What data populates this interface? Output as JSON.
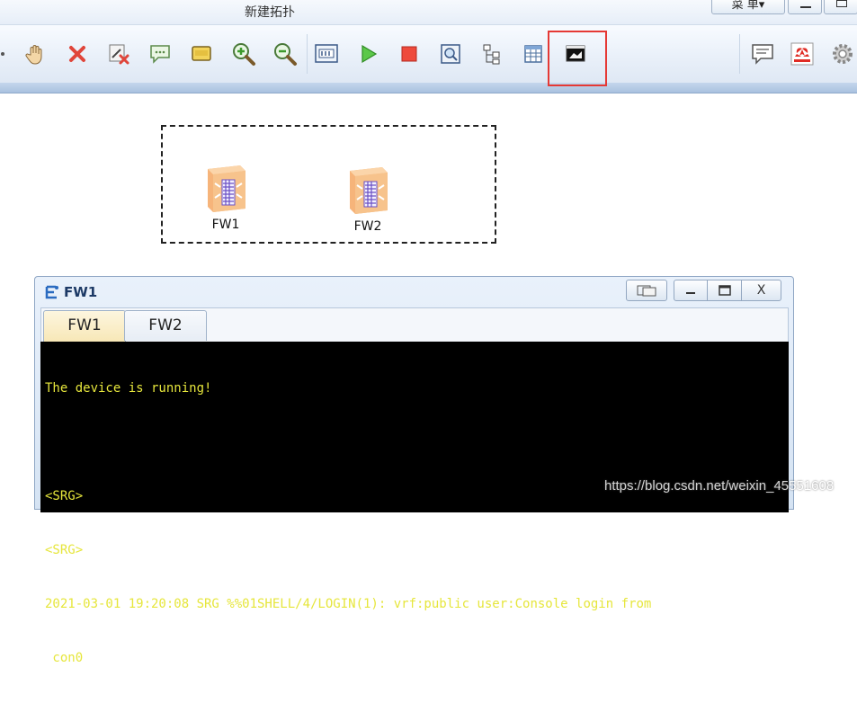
{
  "app": {
    "title": "新建拓扑",
    "menu_label": "菜 单▾"
  },
  "toolbar": {
    "buttons": [
      "hand-drag-icon",
      "delete-icon",
      "delete-link-icon",
      "text-comment-icon",
      "palette-icon",
      "zoom-in-icon",
      "zoom-out-icon",
      "topology-id-icon",
      "start-device-icon",
      "stop-device-icon",
      "capture-icon",
      "tree-view-icon",
      "grid-icon",
      "console-cli-icon",
      "chat-icon",
      "huawei-icon",
      "settings-icon"
    ],
    "highlighted": "console-cli-icon"
  },
  "canvas": {
    "devices": [
      {
        "label": "FW1"
      },
      {
        "label": "FW2"
      }
    ]
  },
  "console": {
    "title": "FW1",
    "buttons": {
      "close_label": "X"
    },
    "tabs": [
      {
        "label": "FW1",
        "active": true
      },
      {
        "label": "FW2",
        "active": false
      }
    ],
    "lines": [
      "The device is running!",
      "",
      "<SRG>",
      "<SRG>",
      "2021-03-01 19:20:08 SRG %%01SHELL/4/LOGIN(1): vrf:public user:Console login from",
      " con0"
    ]
  },
  "watermark": "https://blog.csdn.net/weixin_45551608",
  "colors": {
    "terminal_bg": "#000000",
    "terminal_text": "#e6e63c",
    "highlight_box": "#e53935"
  }
}
